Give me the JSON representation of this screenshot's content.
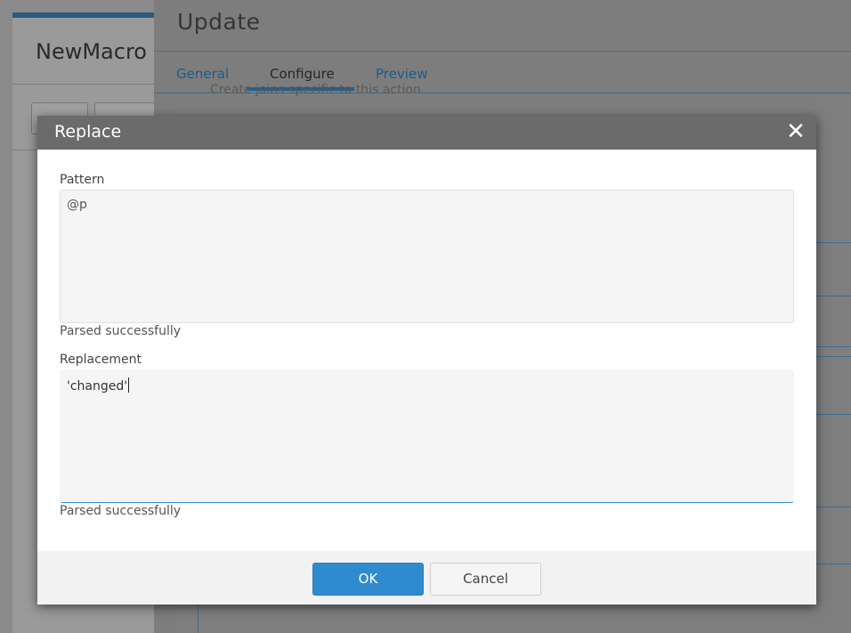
{
  "background": {
    "left_panel_title": "NewMacro",
    "update_title": "Update",
    "tabs": [
      {
        "label": "General"
      },
      {
        "label": "Configure",
        "active": true
      },
      {
        "label": "Preview"
      }
    ],
    "hint_text": "Create joins specific to this action"
  },
  "dialog": {
    "title": "Replace",
    "close_icon": "close-icon",
    "pattern": {
      "label": "Pattern",
      "value": "@p",
      "status": "Parsed successfully"
    },
    "replacement": {
      "label": "Replacement",
      "value": "'changed'",
      "status": "Parsed successfully"
    },
    "ok_label": "OK",
    "cancel_label": "Cancel"
  },
  "colors": {
    "accent": "#2e8bd0",
    "dialog_header": "#6b6b6b",
    "tab_link": "#1f5a85"
  }
}
